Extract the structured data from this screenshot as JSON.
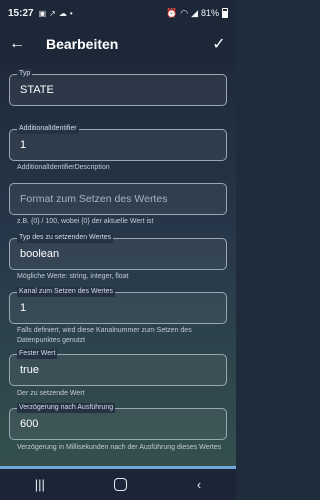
{
  "status_bar": {
    "time": "15:27",
    "battery_text": "81%"
  },
  "app_bar": {
    "title": "Bearbeiten",
    "back_icon": "←",
    "confirm_icon": "✓"
  },
  "form": {
    "typ": {
      "label": "Typ",
      "value": "STATE"
    },
    "additional_identifier": {
      "label": "AdditionalIdentifier",
      "value": "1",
      "helper": "AdditionalIdentifierDescription"
    },
    "format": {
      "placeholder": "Format zum Setzen des Wertes",
      "helper": "z.B. {0} / 100, wobei {0} der aktuelle Wert ist"
    },
    "value_type": {
      "label": "Typ des zu setzenden Wertes",
      "value": "boolean",
      "helper": "Mögliche Werte: string, integer, float"
    },
    "channel": {
      "label": "Kanal zum Setzen des Wertes",
      "value": "1",
      "helper": "Falls definiert, wird diese Kanalnummer zum Setzen des Datenpunktes genutzt"
    },
    "fixed_value": {
      "label": "Fester Wert",
      "value": "true",
      "helper": "Der zu setzende Wert"
    },
    "delay": {
      "label": "Verzögerung nach Ausführung",
      "value": "600",
      "helper": "Verzögerung in Millisekunden nach der Ausführung dieses Wertes"
    }
  },
  "nav_bar": {
    "recents_icon": "|||",
    "back_icon": "‹"
  }
}
